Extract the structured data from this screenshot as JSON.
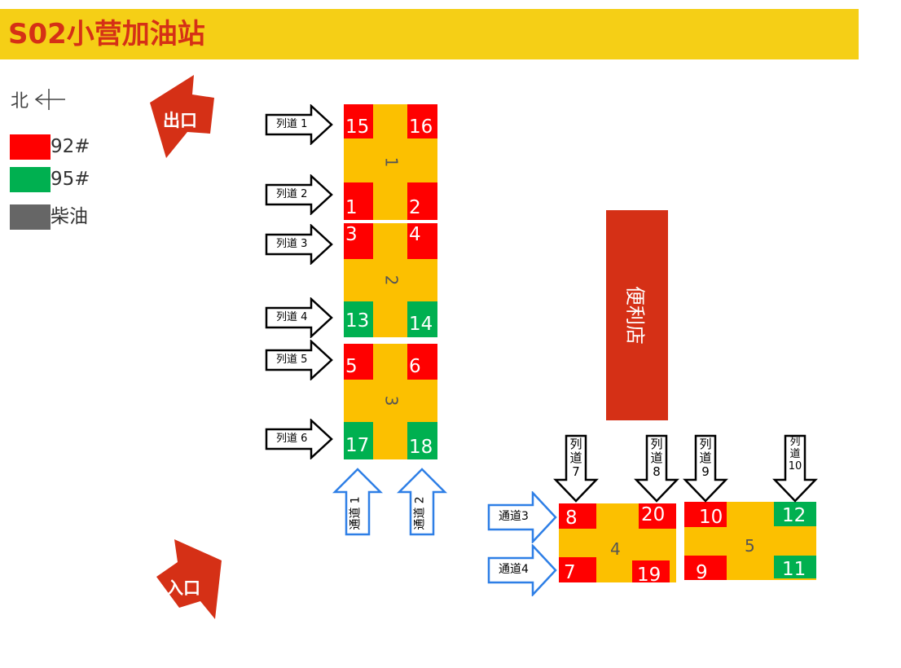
{
  "title": "S02小营加油站",
  "colors": {
    "title_bg": "#f5cf16",
    "title_text": "#d53016",
    "fuel_92": "#ff0000",
    "fuel_95": "#00b050",
    "diesel": "#666666",
    "island": "#fcc000",
    "store": "#d53016",
    "lane_arrow": "#000000",
    "channel_arrow": "#2e7fe6"
  },
  "compass": {
    "label": "北",
    "icon": "arrow-west-icon"
  },
  "legend": [
    {
      "label": "92#",
      "color": "#ff0000"
    },
    {
      "label": "95#",
      "color": "#00b050"
    },
    {
      "label": "柴油",
      "color": "#666666"
    }
  ],
  "exit_label": "出口",
  "entrance_label": "入口",
  "store_label": "便利店",
  "islands": [
    {
      "id": "1",
      "nozzles": [
        {
          "n": "15",
          "fuel": "92"
        },
        {
          "n": "16",
          "fuel": "92"
        },
        {
          "n": "1",
          "fuel": "92"
        },
        {
          "n": "2",
          "fuel": "92"
        }
      ]
    },
    {
      "id": "2",
      "nozzles": [
        {
          "n": "3",
          "fuel": "92"
        },
        {
          "n": "4",
          "fuel": "92"
        },
        {
          "n": "13",
          "fuel": "95"
        },
        {
          "n": "14",
          "fuel": "95"
        }
      ]
    },
    {
      "id": "3",
      "nozzles": [
        {
          "n": "5",
          "fuel": "92"
        },
        {
          "n": "6",
          "fuel": "92"
        },
        {
          "n": "17",
          "fuel": "95"
        },
        {
          "n": "18",
          "fuel": "95"
        }
      ]
    },
    {
      "id": "4",
      "nozzles": [
        {
          "n": "8",
          "fuel": "92"
        },
        {
          "n": "20",
          "fuel": "92"
        },
        {
          "n": "7",
          "fuel": "92"
        },
        {
          "n": "19",
          "fuel": "92"
        }
      ]
    },
    {
      "id": "5",
      "nozzles": [
        {
          "n": "10",
          "fuel": "92"
        },
        {
          "n": "12",
          "fuel": "95"
        },
        {
          "n": "9",
          "fuel": "92"
        },
        {
          "n": "11",
          "fuel": "95"
        }
      ]
    }
  ],
  "lanes": [
    {
      "label": "列道 1"
    },
    {
      "label": "列道 2"
    },
    {
      "label": "列道 3"
    },
    {
      "label": "列道 4"
    },
    {
      "label": "列道 5"
    },
    {
      "label": "列道 6"
    },
    {
      "label": "列道7"
    },
    {
      "label": "列道8"
    },
    {
      "label": "列道9"
    },
    {
      "label": "列道10"
    }
  ],
  "channels": [
    {
      "label": "通道 1"
    },
    {
      "label": "通道 2"
    },
    {
      "label": "通道3"
    },
    {
      "label": "通道4"
    }
  ]
}
